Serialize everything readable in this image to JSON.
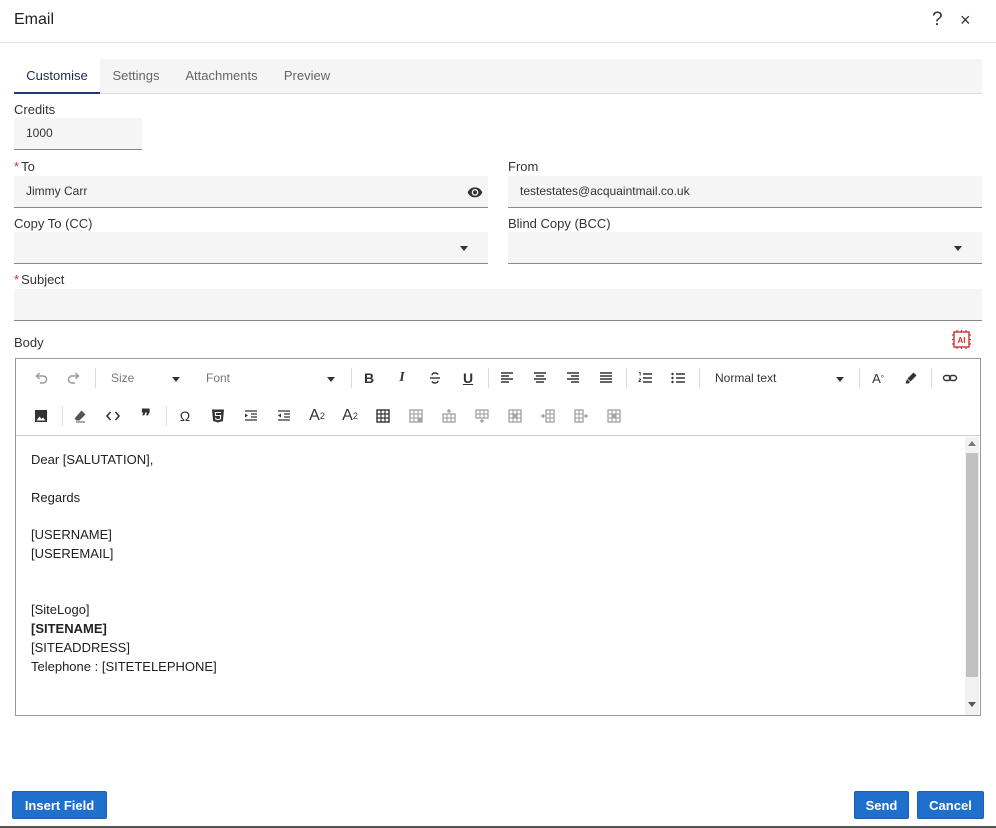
{
  "dialog": {
    "title": "Email",
    "help_label": "?",
    "close_label": "×"
  },
  "tabs": [
    {
      "label": "Customise",
      "active": true
    },
    {
      "label": "Settings",
      "active": false
    },
    {
      "label": "Attachments",
      "active": false
    },
    {
      "label": "Preview",
      "active": false
    }
  ],
  "form": {
    "credits": {
      "label": "Credits",
      "value": "1000"
    },
    "to": {
      "required_mark": "*",
      "label": "To",
      "value": "Jimmy Carr",
      "icon": "eye-icon"
    },
    "from": {
      "label": "From",
      "value": "testestates@acquaintmail.co.uk"
    },
    "cc": {
      "label": "Copy To (CC)",
      "value": ""
    },
    "bcc": {
      "label": "Blind Copy (BCC)",
      "value": ""
    },
    "subject": {
      "required_mark": "*",
      "label": "Subject",
      "value": ""
    },
    "body_label": "Body"
  },
  "toolbar": {
    "size_label": "Size",
    "font_label": "Font",
    "format_label": "Normal text",
    "bold": "B",
    "italic": "I",
    "underline": "U",
    "omega": "Ω",
    "quote": "❞",
    "subscript": "A",
    "subscript_sub": "2",
    "superscript": "A",
    "superscript_sup": "2",
    "font_color": "A"
  },
  "body": {
    "lines": [
      "Dear [SALUTATION],",
      "",
      "Regards",
      "",
      "[USERNAME]",
      "[USEREMAIL]",
      "",
      "",
      "[SiteLogo]",
      "[SITENAME]",
      "[SITEADDRESS]",
      "Telephone : [SITETELEPHONE]"
    ]
  },
  "footer": {
    "insert_field_label": "Insert Field",
    "send_label": "Send",
    "cancel_label": "Cancel"
  },
  "colors": {
    "primary_button": "#1f6fcc",
    "active_tab_border": "#1d3a6e",
    "required": "#d32f2f",
    "ai_icon": "#d32f2f"
  }
}
